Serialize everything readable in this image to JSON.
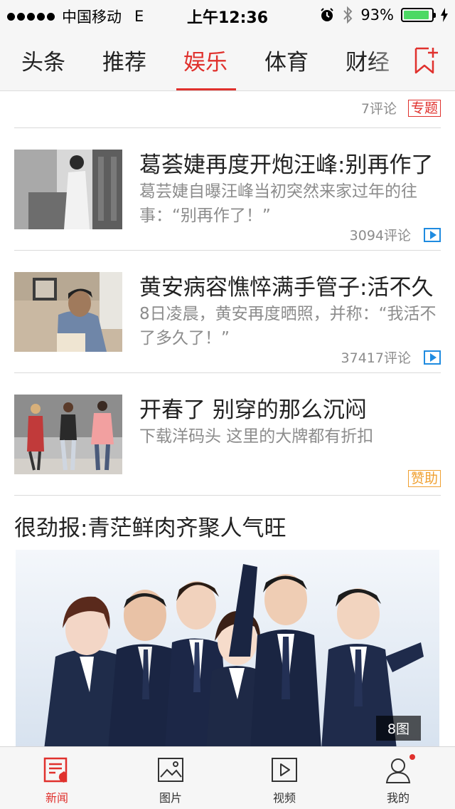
{
  "status": {
    "carrier": "中国移动",
    "network": "E",
    "time": "上午12:36",
    "battery": "93%",
    "battery_level": 0.93
  },
  "tabs": [
    {
      "label": "头条"
    },
    {
      "label": "推荐"
    },
    {
      "label": "娱乐"
    },
    {
      "label": "体育"
    },
    {
      "label": "财经"
    }
  ],
  "prev_item": {
    "comments": "7评论",
    "tag": "专题"
  },
  "news": [
    {
      "title": "葛荟婕再度开炮汪峰:别再作了",
      "summary": "葛芸婕自曝汪峰当初突然来家过年的往事：“别再作了！”",
      "comments": "3094评论",
      "has_video": true
    },
    {
      "title": "黄安病容憔悴满手管子:活不久",
      "summary": "8日凌晨，黄安再度晒照，并称：“我活不了多久了！”",
      "comments": "37417评论",
      "has_video": true
    },
    {
      "title": "开春了 别穿的那么沉闷",
      "summary": "下载洋码头 这里的大牌都有折扣",
      "tag": "赞助"
    }
  ],
  "photo_set": {
    "title": "很劲报:青茫鲜肉齐聚人气旺",
    "count": "8图"
  },
  "bottom_nav": [
    {
      "label": "新闻",
      "icon": "news-icon"
    },
    {
      "label": "图片",
      "icon": "picture-icon"
    },
    {
      "label": "视频",
      "icon": "video-icon"
    },
    {
      "label": "我的",
      "icon": "user-icon"
    }
  ],
  "colors": {
    "accent": "#e0312d",
    "video_blue": "#1f8be0",
    "sponsor_orange": "#f0a030"
  }
}
